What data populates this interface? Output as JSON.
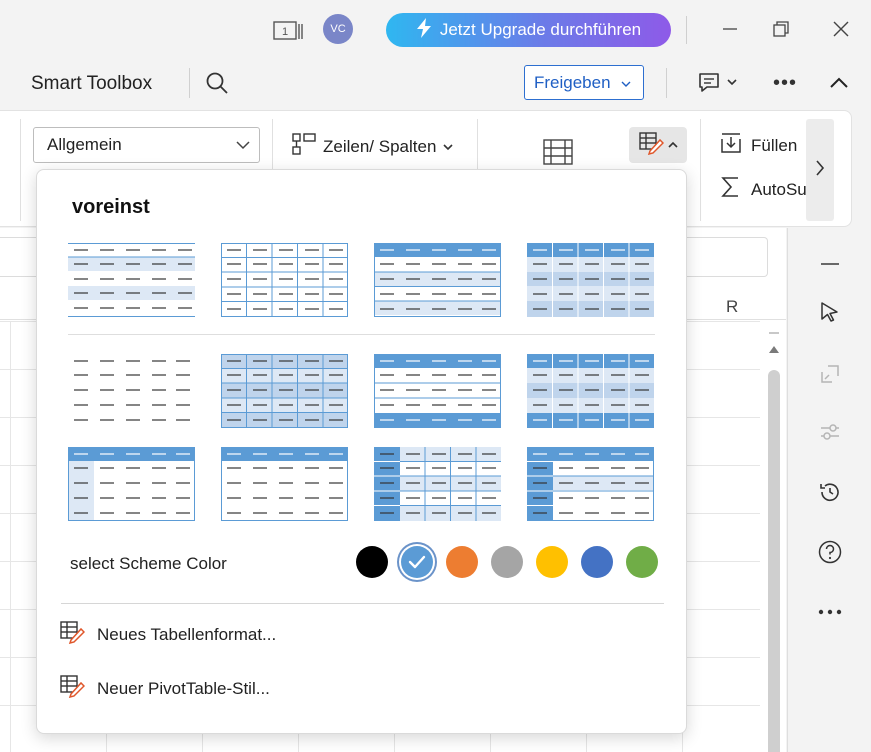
{
  "titlebar": {
    "avatar_initials": "VC",
    "upgrade_label": "Jetzt Upgrade durchführen",
    "icons": [
      "page-layout-icon",
      "lightning-icon",
      "minimize-icon",
      "restore-icon",
      "close-icon"
    ]
  },
  "toolbar": {
    "app_name": "Smart Toolbox",
    "share_label": "Freigeben",
    "more_label": "•••"
  },
  "ribbon": {
    "number_format": "Allgemein",
    "rows_cols_label": "Zeilen/ Spalten",
    "fill_label": "Füllen",
    "autosum_label": "AutoSu"
  },
  "sheet": {
    "column_header": "R"
  },
  "dropdown": {
    "title": "voreinst",
    "scheme_label": "select Scheme Color",
    "scheme_colors": [
      "#000000",
      "#5b9bd5",
      "#ed7d31",
      "#a5a5a5",
      "#ffc000",
      "#4472c4",
      "#70ad47"
    ],
    "selected_color_index": 1,
    "actions": [
      {
        "label": "Neues Tabellenformat..."
      },
      {
        "label": "Neuer PivotTable-Stil..."
      }
    ]
  },
  "colors": {
    "accent": "#5b9bd5",
    "accent_light": "#dde8f5",
    "accent_mid": "#bfd4ec"
  }
}
